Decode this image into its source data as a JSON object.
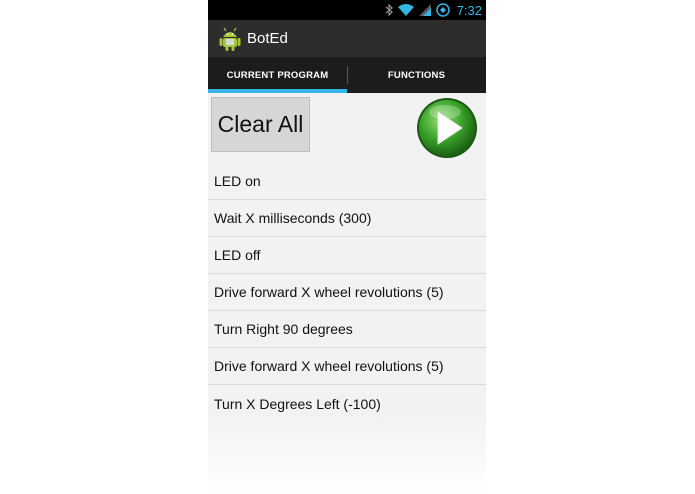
{
  "status_bar": {
    "time": "7:32",
    "icons": [
      "bluetooth-icon",
      "wifi-icon",
      "cell-signal-icon",
      "battery-icon"
    ],
    "accent_color": "#33b5e5"
  },
  "action_bar": {
    "title": "BotEd",
    "icon": "android-robot-icon"
  },
  "tabs": [
    {
      "label": "CURRENT PROGRAM",
      "active": true
    },
    {
      "label": "FUNCTIONS",
      "active": false
    }
  ],
  "toolbar": {
    "clear_label": "Clear All",
    "play_icon": "play-icon"
  },
  "program": [
    {
      "label": "LED on"
    },
    {
      "label": "Wait X milliseconds (300)"
    },
    {
      "label": "LED off"
    },
    {
      "label": "Drive forward X wheel revolutions (5)"
    },
    {
      "label": "Turn Right 90 degrees"
    },
    {
      "label": "Drive forward X wheel revolutions (5)"
    },
    {
      "label": "Turn X Degrees Left (-100)"
    }
  ],
  "colors": {
    "tab_indicator": "#33b5e5",
    "action_bar": "#2d2d2d",
    "tab_bar": "#1c1c1c",
    "play_green": "#3aa52a"
  }
}
